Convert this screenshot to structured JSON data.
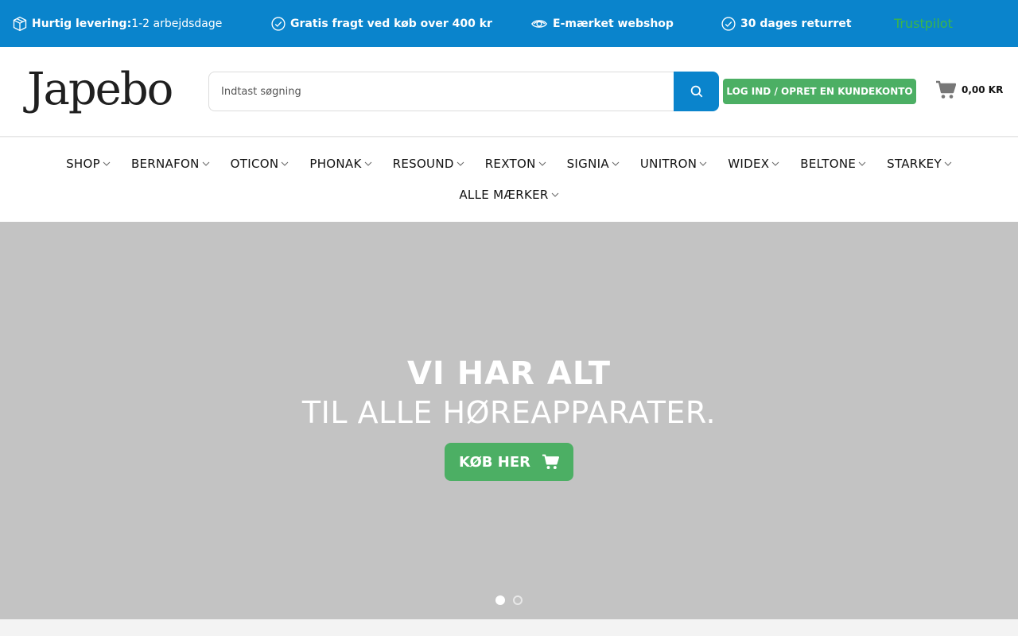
{
  "topbar": {
    "items": [
      {
        "bold": "Hurtig levering:",
        "text": " 1-2 arbejdsdage",
        "icon": "box-icon"
      },
      {
        "bold": "Gratis fragt ved køb over 400 kr",
        "text": "",
        "icon": "check-circle-icon"
      },
      {
        "bold": "E-mærket webshop",
        "text": "",
        "icon": "eye-icon"
      },
      {
        "bold": "30 dages returret",
        "text": "",
        "icon": "check-circle-icon"
      }
    ],
    "trustpilot": "Trustpilot",
    "background": "#0a84cc"
  },
  "header": {
    "logo": "Japebo",
    "search": {
      "placeholder": "Indtast søgning",
      "value": ""
    },
    "login_label": "LOG IND / OPRET EN KUNDEKONTO",
    "cart_amount": "0,00 KR"
  },
  "nav": {
    "row1": [
      "SHOP",
      "BERNAFON",
      "OTICON",
      "PHONAK",
      "RESOUND",
      "REXTON",
      "SIGNIA",
      "UNITRON",
      "WIDEX",
      "BELTONE",
      "STARKEY"
    ],
    "row2": [
      "ALLE MÆRKER"
    ]
  },
  "hero": {
    "title": "VI HAR ALT",
    "subtitle": "TIL ALLE HØREAPPARATER.",
    "button_label": "KØB HER",
    "slides_total": 2,
    "active_slide": 1
  },
  "colors": {
    "accent": "#0a84cc",
    "green": "#4caf64",
    "hero_bg": "#c3c3c3"
  }
}
